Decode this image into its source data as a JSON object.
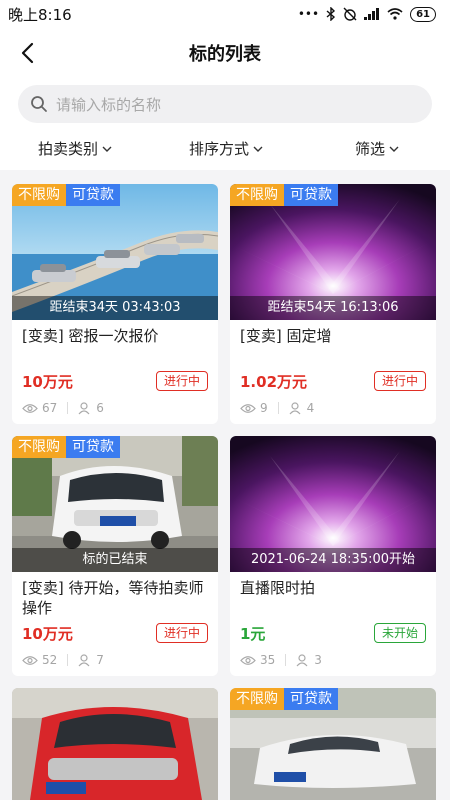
{
  "status_bar": {
    "time": "晚上8:16",
    "signal_dots": "•••",
    "battery": "61"
  },
  "nav": {
    "title": "标的列表"
  },
  "search": {
    "placeholder": "请输入标的名称"
  },
  "filters": [
    {
      "label": "拍卖类别"
    },
    {
      "label": "排序方式"
    },
    {
      "label": "筛选"
    }
  ],
  "cards": [
    {
      "tags": [
        "不限购",
        "可贷款"
      ],
      "time_text": "距结束34天 03:43:03",
      "title": "[变卖] 密报一次报价",
      "price": "10万元",
      "price_color": "#e02e24",
      "status": "进行中",
      "views": "67",
      "bidders": "6",
      "image_icon": "bridge-cars-image"
    },
    {
      "tags": [
        "不限购",
        "可贷款"
      ],
      "time_text": "距结束54天 16:13:06",
      "title": "[变卖] 固定增",
      "price": "1.02万元",
      "price_color": "#e02e24",
      "status": "进行中",
      "views": "9",
      "bidders": "4",
      "image_icon": "aurora-image"
    },
    {
      "tags": [
        "不限购",
        "可贷款"
      ],
      "time_text": "标的已结束",
      "title": "[变卖] 待开始，等待拍卖师操作",
      "price": "10万元",
      "price_color": "#e02e24",
      "status": "进行中",
      "views": "52",
      "bidders": "7",
      "image_icon": "white-van-image"
    },
    {
      "tags": [],
      "time_text": "2021-06-24 18:35:00开始",
      "title": "直播限时拍",
      "price": "1元",
      "price_color": "#2aa63a",
      "status": "未开始",
      "views": "35",
      "bidders": "3",
      "image_icon": "aurora-image"
    },
    {
      "tags": [],
      "image_icon": "red-smart-car-image"
    },
    {
      "tags": [
        "不限购",
        "可贷款"
      ],
      "image_icon": "white-sedan-image"
    }
  ],
  "colors": {
    "accent_red": "#e02e24",
    "accent_green": "#2aa63a",
    "tag_orange": "#f5a623",
    "tag_blue": "#3b7cf0"
  }
}
